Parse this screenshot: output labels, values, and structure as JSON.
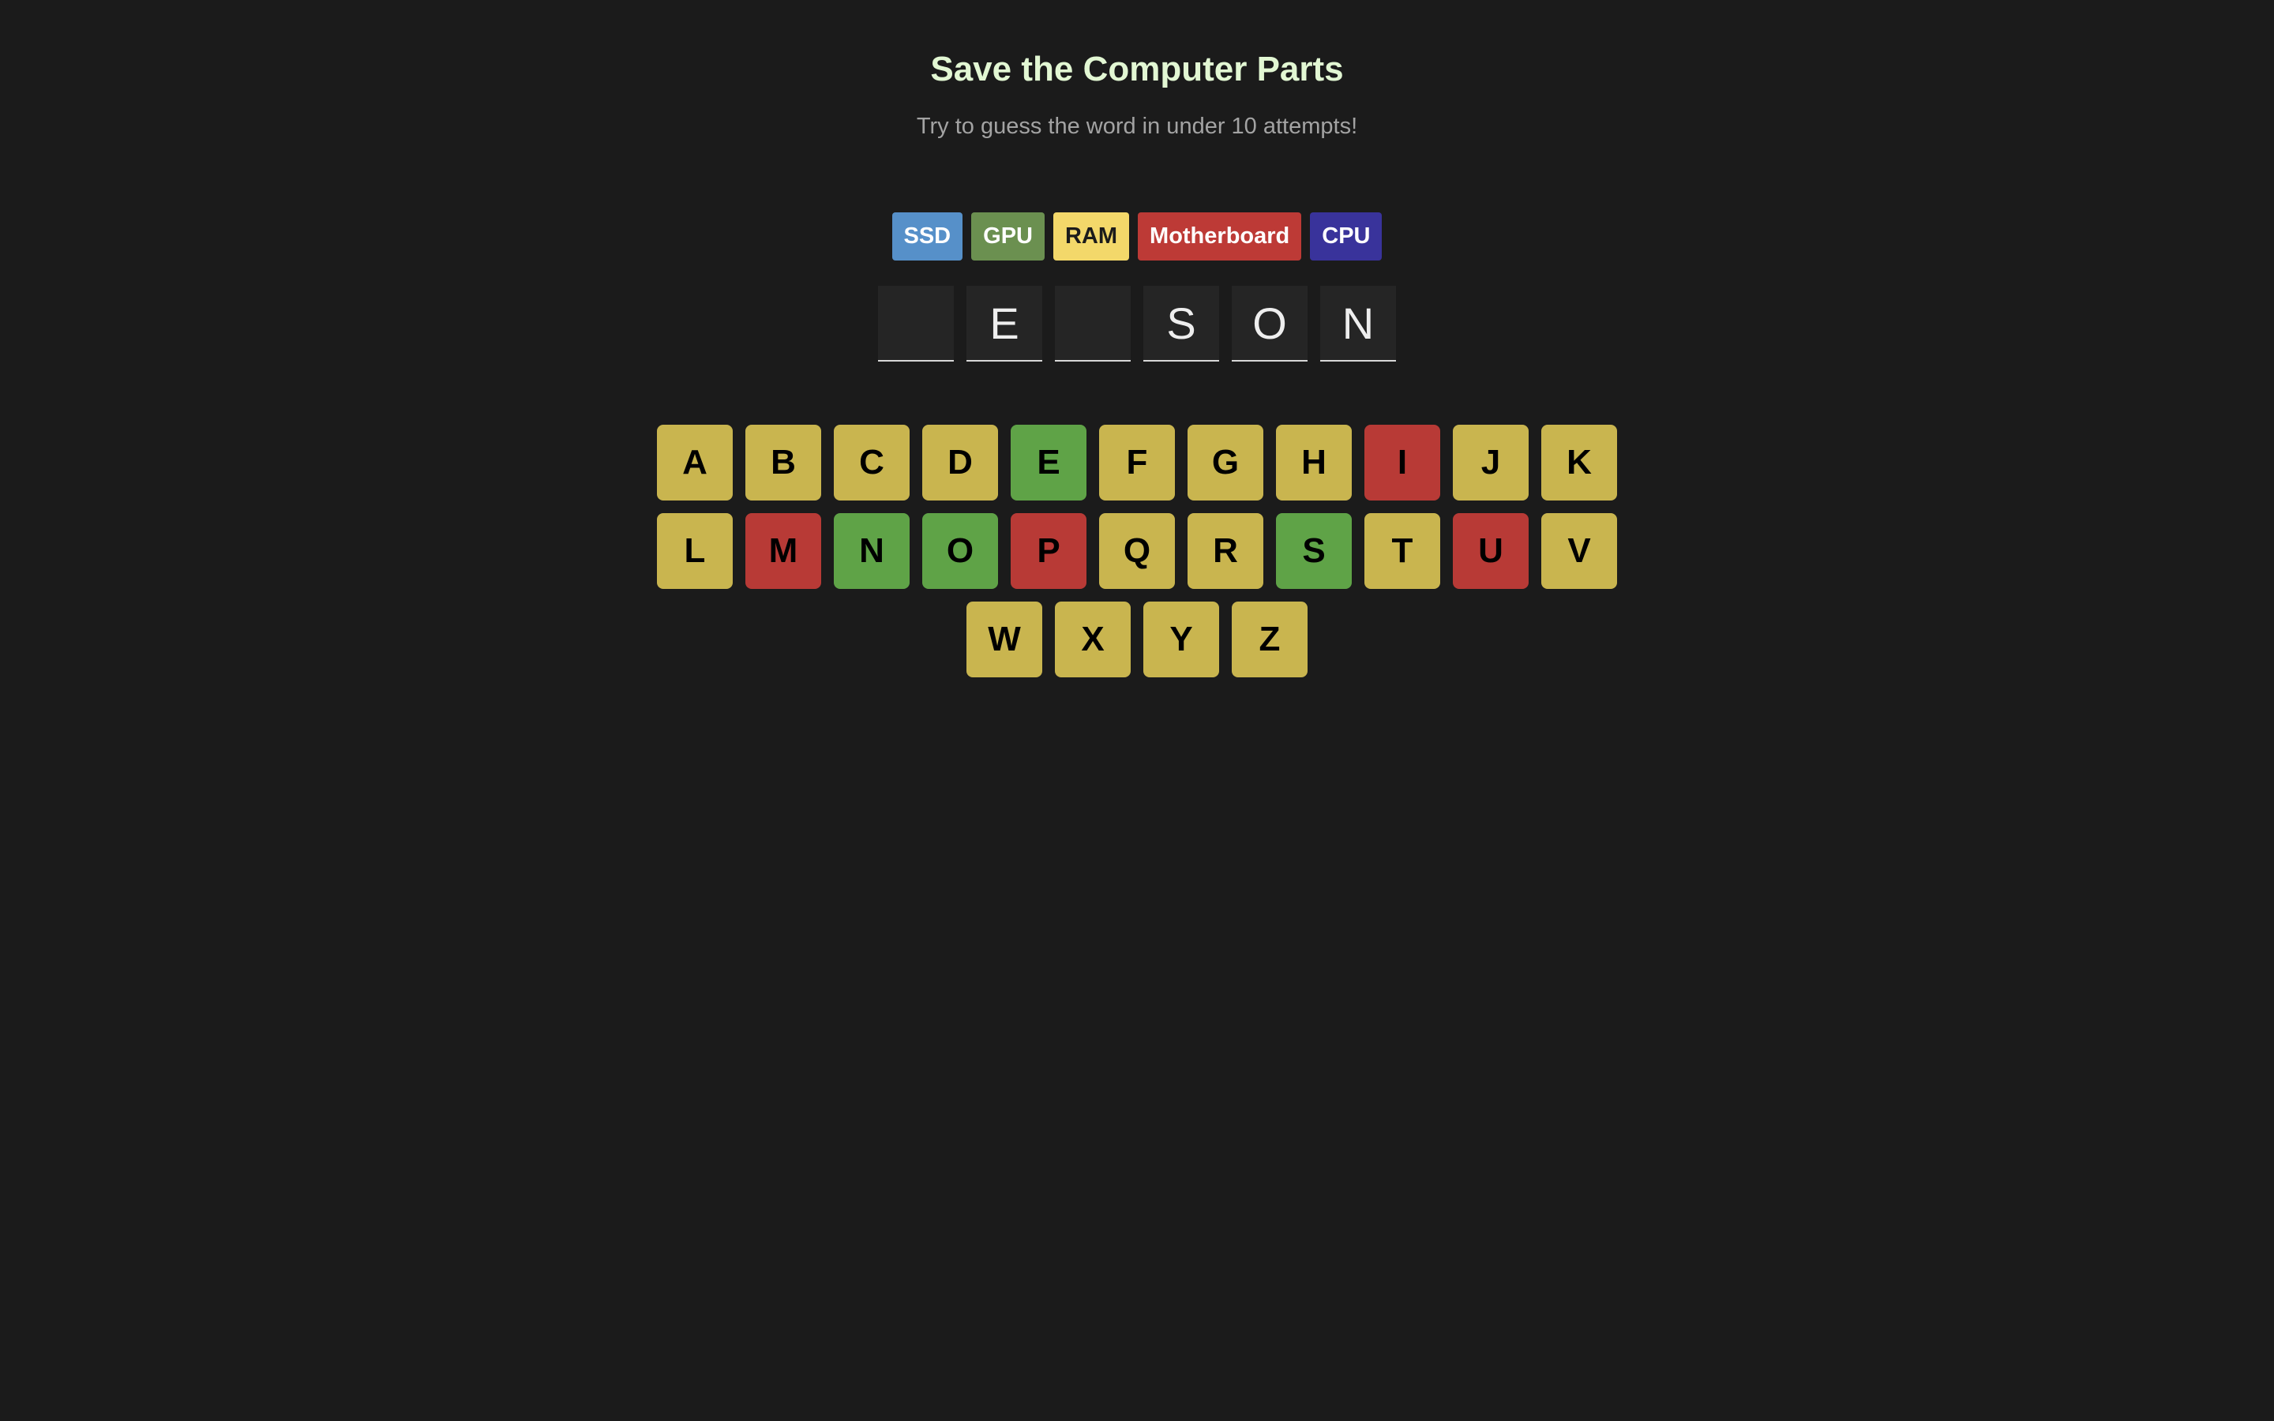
{
  "game": {
    "title": "Save the Computer Parts",
    "subtitle": "Try to guess the word in under 10 attempts!"
  },
  "parts": [
    {
      "label": "SSD",
      "color": "#5690c9",
      "text_color": "#ffffff"
    },
    {
      "label": "GPU",
      "color": "#6b9050",
      "text_color": "#ffffff"
    },
    {
      "label": "RAM",
      "color": "#f3d86a",
      "text_color": "#1b1b1b"
    },
    {
      "label": "Motherboard",
      "color": "#bd3a36",
      "text_color": "#ffffff"
    },
    {
      "label": "CPU",
      "color": "#39339b",
      "text_color": "#ffffff"
    }
  ],
  "word_slots": [
    "",
    "E",
    "",
    "S",
    "O",
    "N"
  ],
  "keyboard": {
    "rows": [
      [
        {
          "letter": "A",
          "state": "unused"
        },
        {
          "letter": "B",
          "state": "unused"
        },
        {
          "letter": "C",
          "state": "unused"
        },
        {
          "letter": "D",
          "state": "unused"
        },
        {
          "letter": "E",
          "state": "correct"
        },
        {
          "letter": "F",
          "state": "unused"
        },
        {
          "letter": "G",
          "state": "unused"
        },
        {
          "letter": "H",
          "state": "unused"
        },
        {
          "letter": "I",
          "state": "wrong"
        },
        {
          "letter": "J",
          "state": "unused"
        },
        {
          "letter": "K",
          "state": "unused"
        }
      ],
      [
        {
          "letter": "L",
          "state": "unused"
        },
        {
          "letter": "M",
          "state": "wrong"
        },
        {
          "letter": "N",
          "state": "correct"
        },
        {
          "letter": "O",
          "state": "correct"
        },
        {
          "letter": "P",
          "state": "wrong"
        },
        {
          "letter": "Q",
          "state": "unused"
        },
        {
          "letter": "R",
          "state": "unused"
        },
        {
          "letter": "S",
          "state": "correct"
        },
        {
          "letter": "T",
          "state": "unused"
        },
        {
          "letter": "U",
          "state": "wrong"
        },
        {
          "letter": "V",
          "state": "unused"
        }
      ],
      [
        {
          "letter": "W",
          "state": "unused"
        },
        {
          "letter": "X",
          "state": "unused"
        },
        {
          "letter": "Y",
          "state": "unused"
        },
        {
          "letter": "Z",
          "state": "unused"
        }
      ]
    ]
  },
  "colors": {
    "background": "#1b1b1b",
    "title": "#e2f7d3",
    "subtitle": "#a3a3a3",
    "key_unused": "#c9b54f",
    "key_correct": "#5fa347",
    "key_wrong": "#b83a36"
  }
}
